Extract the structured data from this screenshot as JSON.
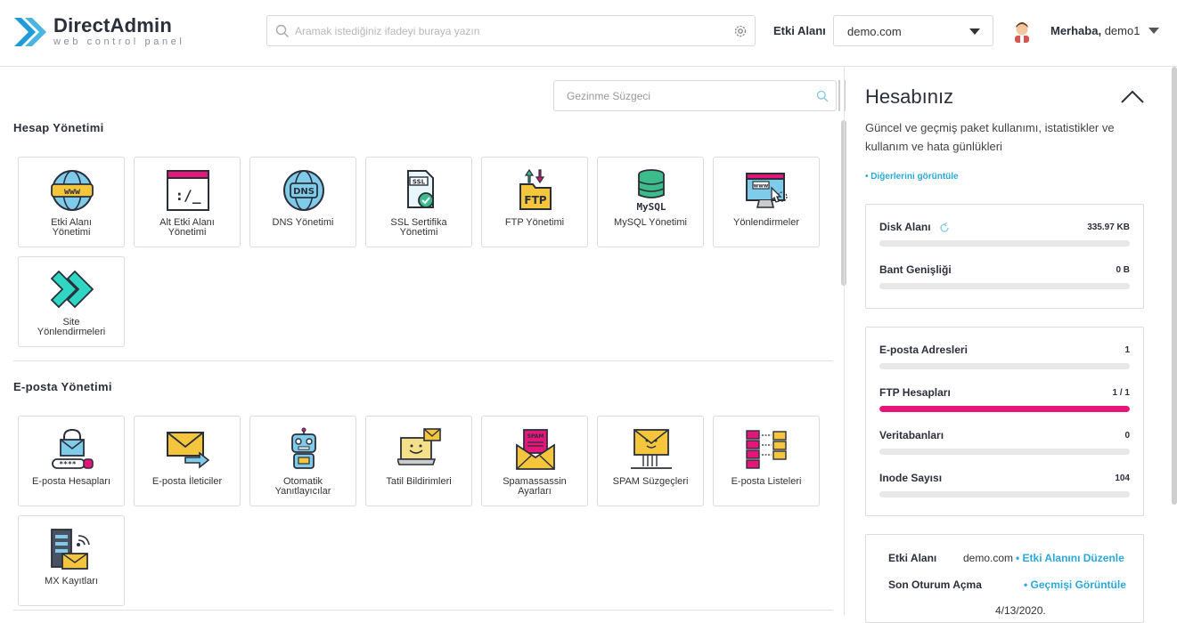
{
  "brand": {
    "name": "DirectAdmin",
    "tagline": "web control panel"
  },
  "header": {
    "search_placeholder": "Aramak istediğiniz ifadeyi buraya yazın",
    "domain_label": "Etki Alanı",
    "domain_value": "demo.com",
    "greeting": "Merhaba,",
    "username": "demo1"
  },
  "filter": {
    "placeholder": "Gezinme Süzgeci"
  },
  "sections": {
    "account": {
      "title": "Hesap Yönetimi",
      "tiles": [
        {
          "label": "Etki Alanı\nYönetimi",
          "icon": "globe-www-icon"
        },
        {
          "label": "Alt Etki Alanı\nYönetimi",
          "icon": "terminal-window-icon"
        },
        {
          "label": "DNS Yönetimi",
          "icon": "globe-dns-icon"
        },
        {
          "label": "SSL Sertifika\nYönetimi",
          "icon": "ssl-certificate-icon"
        },
        {
          "label": "FTP Yönetimi",
          "icon": "ftp-folder-icon"
        },
        {
          "label": "MySQL Yönetimi",
          "icon": "mysql-database-icon"
        },
        {
          "label": "Yönlendirmeler",
          "icon": "redirect-monitor-icon"
        },
        {
          "label": "Site\nYönlendirmeleri",
          "icon": "site-redirect-arrows-icon"
        }
      ]
    },
    "email": {
      "title": "E-posta Yönetimi",
      "tiles": [
        {
          "label": "E-posta Hesapları",
          "icon": "email-account-lock-icon"
        },
        {
          "label": "E-posta İleticiler",
          "icon": "email-forward-icon"
        },
        {
          "label": "Otomatik\nYanıtlayıcılar",
          "icon": "robot-autoresponder-icon"
        },
        {
          "label": "Tatil Bildirimleri",
          "icon": "vacation-laptop-icon"
        },
        {
          "label": "Spamassassin\nAyarları",
          "icon": "spam-envelope-icon"
        },
        {
          "label": "SPAM Süzgeçleri",
          "icon": "spam-filter-envelope-icon"
        },
        {
          "label": "E-posta Listeleri",
          "icon": "email-list-icon"
        },
        {
          "label": "MX Kayıtları",
          "icon": "mx-server-icon"
        }
      ]
    }
  },
  "sidebar": {
    "title": "Hesabınız",
    "description": "Güncel ve geçmiş paket kullanımı, istatistikler ve kullanım ve hata günlükleri",
    "more_link": "• Diğerlerini görüntüle",
    "usage": [
      {
        "label": "Disk Alanı",
        "value": "335.97 KB",
        "fraction": 0
      },
      {
        "label": "Bant Genişliği",
        "value": "0 B",
        "fraction": 0
      }
    ],
    "counts": [
      {
        "label": "E-posta Adresleri",
        "value": "1",
        "fraction": 0
      },
      {
        "label": "FTP Hesapları",
        "value": "1 / 1",
        "fraction": 1
      },
      {
        "label": "Veritabanları",
        "value": "0",
        "fraction": 0
      },
      {
        "label": "Inode Sayısı",
        "value": "104",
        "fraction": 0
      }
    ],
    "info": {
      "domain_label": "Etki Alanı",
      "domain_value": "demo.com",
      "domain_link": "• Etki Alanını Düzenle",
      "last_login_label": "Son Oturum Açma",
      "last_login_link": "• Geçmişi Görüntüle",
      "last_login_value": "4/13/2020."
    }
  },
  "colors": {
    "accent": "#2aa9d8",
    "brand": "#1f9bd7",
    "usage_bar": "#e5157a"
  }
}
